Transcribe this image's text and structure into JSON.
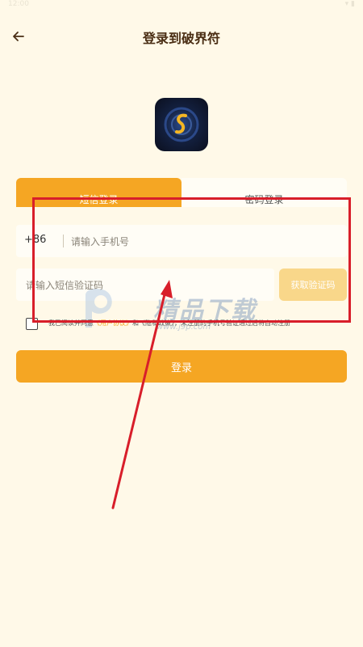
{
  "status_bar": {
    "time": "12:00",
    "icons": "▾ ▮"
  },
  "header": {
    "title": "登录到破界符",
    "back_icon": "arrow-left-icon"
  },
  "tabs": [
    {
      "label": "短信登录",
      "active": true
    },
    {
      "label": "密码登录",
      "active": false
    }
  ],
  "phone": {
    "country_code": "+86",
    "placeholder": "请输入手机号"
  },
  "sms_code": {
    "placeholder": "请输入短信验证码",
    "button_label": "获取验证码"
  },
  "agreement": {
    "prefix": "我已阅读并同意",
    "link": "《用户协议》",
    "suffix": "和《隐私政策》，未注册的手机号验证通过后将自动注册",
    "checked": false
  },
  "login_button": {
    "label": "登录"
  },
  "watermark": {
    "text": "精品下载",
    "url": "www.j9p.com"
  },
  "colors": {
    "accent": "#F5A623",
    "background": "#FFF9E8",
    "annotation": "#D81E2A"
  }
}
